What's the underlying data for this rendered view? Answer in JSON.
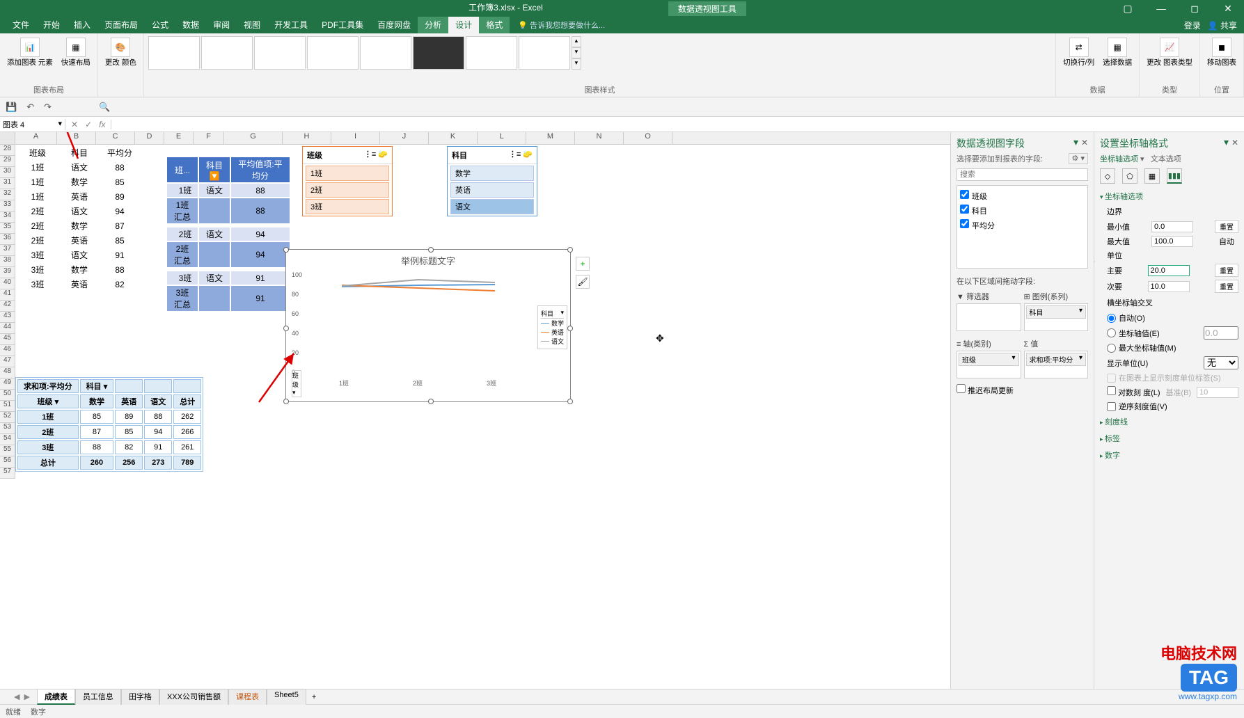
{
  "title": {
    "filename": "工作簿3.xlsx - Excel",
    "context_tool": "数据透视图工具"
  },
  "window_controls": {
    "ribbon_opts": "▢",
    "min": "—",
    "max": "◻",
    "close": "✕"
  },
  "menu": {
    "tabs": [
      "文件",
      "开始",
      "插入",
      "页面布局",
      "公式",
      "数据",
      "审阅",
      "视图",
      "开发工具",
      "PDF工具集",
      "百度网盘",
      "分析",
      "设计",
      "格式"
    ],
    "active": "设计",
    "context_tabs": [
      "分析",
      "设计",
      "格式"
    ],
    "tell_me": "告诉我您想要做什么...",
    "login": "登录",
    "share": "共享"
  },
  "ribbon": {
    "groups": {
      "layout": {
        "label": "图表布局",
        "add_element": "添加图表\n元素",
        "quick_layout": "快速布局"
      },
      "colors": {
        "change_colors": "更改\n颜色"
      },
      "styles": {
        "label": "图表样式"
      },
      "data": {
        "label": "数据",
        "swap": "切换行/列",
        "select": "选择数据"
      },
      "type": {
        "label": "类型",
        "change": "更改\n图表类型"
      },
      "location": {
        "label": "位置",
        "move": "移动图表"
      }
    }
  },
  "qat": {
    "save": "💾",
    "undo": "↶",
    "redo": "↷",
    "touch": "☝",
    "find": "🔍"
  },
  "namebox": "图表 4",
  "fx": {
    "cancel": "✕",
    "confirm": "✓",
    "fx": "fx"
  },
  "columns": [
    "A",
    "B",
    "C",
    "D",
    "E",
    "F",
    "G",
    "H",
    "I",
    "J",
    "K",
    "L",
    "M",
    "N",
    "O"
  ],
  "rows_start": 28,
  "rows_end": 57,
  "source_table": {
    "headers": [
      "班级",
      "科目",
      "平均分"
    ],
    "rows": [
      [
        "1班",
        "语文",
        "88"
      ],
      [
        "1班",
        "数学",
        "85"
      ],
      [
        "1班",
        "英语",
        "89"
      ],
      [
        "2班",
        "语文",
        "94"
      ],
      [
        "2班",
        "数学",
        "87"
      ],
      [
        "2班",
        "英语",
        "85"
      ],
      [
        "3班",
        "语文",
        "91"
      ],
      [
        "3班",
        "数学",
        "88"
      ],
      [
        "3班",
        "英语",
        "82"
      ]
    ]
  },
  "pivot_table": {
    "headers": [
      "班...",
      "科目",
      "平均值项:平均分"
    ],
    "rows": [
      {
        "c": [
          "1班",
          "语文",
          "88"
        ],
        "cls": "pt-sub1",
        "indent": true
      },
      {
        "c": [
          "1班 汇总",
          "",
          "88"
        ],
        "cls": "pt-sub2"
      },
      {
        "c": [
          "",
          "",
          ""
        ],
        "cls": ""
      },
      {
        "c": [
          "2班",
          "语文",
          "94"
        ],
        "cls": "pt-sub1",
        "indent": true
      },
      {
        "c": [
          "2班 汇总",
          "",
          "94"
        ],
        "cls": "pt-sub2"
      },
      {
        "c": [
          "",
          "",
          ""
        ],
        "cls": ""
      },
      {
        "c": [
          "3班",
          "语文",
          "91"
        ],
        "cls": "pt-sub1",
        "indent": true
      },
      {
        "c": [
          "3班 汇总",
          "",
          "91"
        ],
        "cls": "pt-sub2"
      }
    ]
  },
  "summary_table": {
    "top_left": "求和项:平均分",
    "col_field": "科目",
    "row_field": "班级",
    "cols": [
      "数学",
      "英语",
      "语文",
      "总计"
    ],
    "rows": [
      [
        "1班",
        "85",
        "89",
        "88",
        "262"
      ],
      [
        "2班",
        "87",
        "85",
        "94",
        "266"
      ],
      [
        "3班",
        "88",
        "82",
        "91",
        "261"
      ],
      [
        "总计",
        "260",
        "256",
        "273",
        "789"
      ]
    ]
  },
  "slicer_class": {
    "title": "班级",
    "items": [
      "1班",
      "2班",
      "3班"
    ]
  },
  "slicer_subject": {
    "title": "科目",
    "items": [
      "数学",
      "英语",
      "语文"
    ],
    "selected": "语文"
  },
  "chart": {
    "title": "举例标题文字",
    "legend_title": "科目",
    "series": [
      "数学",
      "英语",
      "语文"
    ],
    "x": [
      "1班",
      "2班",
      "3班"
    ],
    "ylabels": [
      "100",
      "80",
      "60",
      "40",
      "20",
      "0"
    ],
    "dropdown": "班级"
  },
  "chart_data": {
    "type": "line",
    "title": "举例标题文字",
    "categories": [
      "1班",
      "2班",
      "3班"
    ],
    "series": [
      {
        "name": "数学",
        "values": [
          85,
          87,
          88
        ],
        "color": "#5b9bd5"
      },
      {
        "name": "英语",
        "values": [
          89,
          85,
          82
        ],
        "color": "#ed7d31"
      },
      {
        "name": "语文",
        "values": [
          88,
          94,
          91
        ],
        "color": "#a5a5a5"
      }
    ],
    "xlabel": "班级",
    "ylabel": "",
    "ylim": [
      0,
      100
    ],
    "ytick": 20
  },
  "field_pane": {
    "title": "数据透视图字段",
    "subtitle": "选择要添加到报表的字段:",
    "search": "搜索",
    "fields": [
      {
        "n": "班级",
        "c": true
      },
      {
        "n": "科目",
        "c": true
      },
      {
        "n": "平均分",
        "c": true
      }
    ],
    "drag_hint": "在以下区域间拖动字段:",
    "zones": {
      "filter": "筛选器",
      "legend": "图例(系列)",
      "axis": "轴(类别)",
      "values": "值",
      "legend_chip": "科目",
      "axis_chip": "班级",
      "values_chip": "求和项:平均分"
    },
    "defer": "推迟布局更新"
  },
  "format_pane": {
    "title": "设置坐标轴格式",
    "subtitle_l": "坐标轴选项",
    "subtitle_r": "文本选项",
    "section_axis": "坐标轴选项",
    "bounds": "边界",
    "min": "最小值",
    "min_v": "0.0",
    "max": "最大值",
    "max_v": "100.0",
    "units": "单位",
    "major": "主要",
    "major_v": "20.0",
    "minor": "次要",
    "minor_v": "10.0",
    "reset": "重置",
    "auto": "自动",
    "cross": "横坐标轴交叉",
    "cross_auto": "自动(O)",
    "cross_val": "坐标轴值(E)",
    "cross_val_v": "0.0",
    "cross_max": "最大坐标轴值(M)",
    "display_unit": "显示单位(U)",
    "display_unit_v": "无",
    "show_label": "在图表上显示刻度单位标签(S)",
    "log": "对数刻\n度(L)",
    "log_base": "基准(B)",
    "log_v": "10",
    "reverse": "逆序刻度值(V)",
    "ticks": "刻度线",
    "labels": "标签",
    "number": "数字"
  },
  "sheets": {
    "tabs": [
      "成绩表",
      "员工信息",
      "田字格",
      "XXX公司销售额",
      "课程表",
      "Sheet5"
    ],
    "active": "成绩表",
    "orange": "课程表",
    "add": "+"
  },
  "status": {
    "ready": "就绪",
    "calc": "数字"
  },
  "watermark": {
    "t1": "电脑技术网",
    "t2": "TAG",
    "t3": "www.tagxp.com"
  }
}
